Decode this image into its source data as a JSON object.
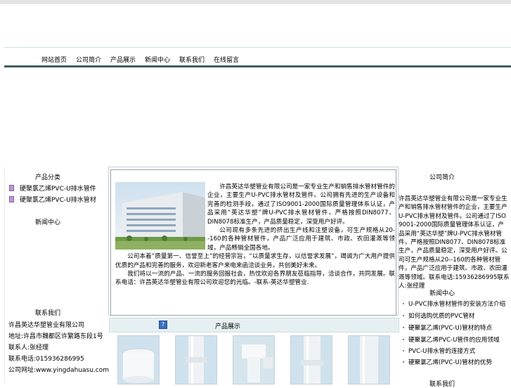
{
  "nav": {
    "items": [
      "网站首页",
      "公司简介",
      "产品展示",
      "新闻中心",
      "联系我们",
      "在线留言"
    ]
  },
  "left": {
    "products_title": "产品分类",
    "product_links": [
      "硬聚氯乙烯PVC-U排水管件",
      "硬聚氯乙烯PVC-U排水管材"
    ],
    "news_title": "新闻中心",
    "contact_title": "联系我们",
    "contact": [
      "许昌英达华塑管业有限公司",
      "地址:许昌市魏都区许繁路东段1号",
      "联系人:张经理",
      "联系电话:015936286995",
      "公司网址:www.yingdahuasu.com"
    ]
  },
  "intro": {
    "paragraphs": [
      "许昌英达华塑管业有限公司是一家专业生产和销售排水管材管件的企业，主要生产U-PVC排水管材及管件。公司拥有先进的生产设备和完善的检测手段，通过了ISO9001-2000国际质量管理体系认证，产品采用“英达华塑”牌U-PVC排水管材管件，严格按照DIN8077、DIN8078标准生产，产品质量稳定，深受用户好评。",
      "公司现有多条先进的挤出生产线和注塑设备，可生产规格从20--160的各种管材管件，产品广泛应用于建筑、市政、农田灌溉等领域，产品畅销全国各地。",
      "公司本着“质量第一、信誉至上”的经营宗旨，“以质量求生存，以信誉求发展”，竭诚为广大用户提供优质的产品和完善的服务，欢迎新老客户来电来函洽谈业务，共创美好未来。",
      "我们将以一流的产品、一流的服务回报社会，热忱欢迎各界朋友莅临指导，洽谈合作，共同发展。联系电话：许昌英达华塑管业有限公司欢迎您的光临。-联系-英达华塑管业."
    ]
  },
  "products": {
    "title": "产品展示",
    "help_icon_label": "?"
  },
  "right": {
    "title": "公司简介",
    "desc": "许昌英达华塑管业有限公司是一家专业生产和销售排水管材管件的企业，主要生产U-PVC排水管材及管件。公司通过了ISO9001-2000国际质量管理体系认证，产品采用“英达华塑”牌U-PVC排水管材管件，严格按照DIN8077、DIN8078标准生产，产品质量稳定，深受用户好评。公司可生产规格从20--160的各种管材管件，产品广泛应用于建筑、市政、农田灌溉等领域。联系电话:15936286995联系人:张经理",
    "news_title": "新闻中心",
    "news": [
      "U-PVC排水管材管件的安装方法介绍",
      "如何选购优质的PVC管材",
      "硬聚氯乙烯(PVC-U)管材的特点",
      "硬聚氯乙烯PVC-U管件的应用领域",
      "PVC-U排水管的连接方式",
      "硬聚氯乙烯(PVC-U)管材的优势"
    ],
    "bottom_title": "联系我们"
  }
}
